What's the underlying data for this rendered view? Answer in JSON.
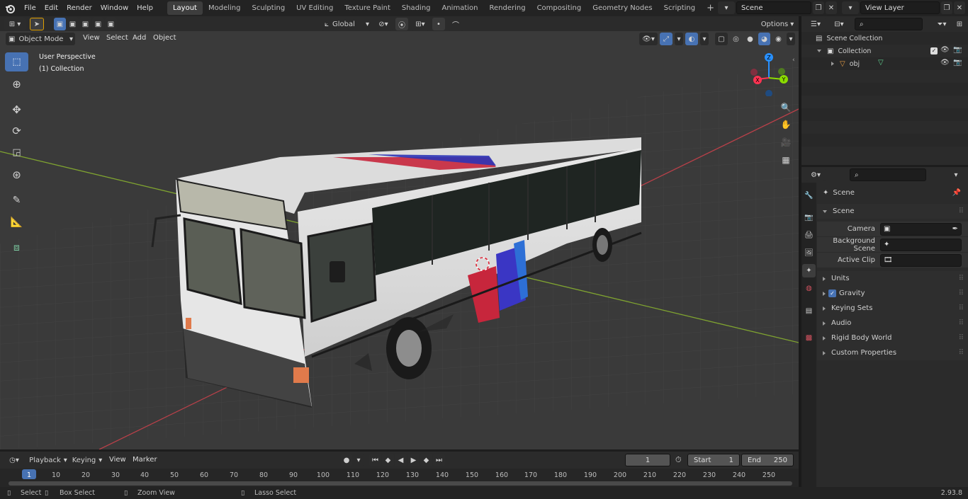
{
  "menus": [
    "File",
    "Edit",
    "Render",
    "Window",
    "Help"
  ],
  "workspaces": [
    "Layout",
    "Modeling",
    "Sculpting",
    "UV Editing",
    "Texture Paint",
    "Shading",
    "Animation",
    "Rendering",
    "Compositing",
    "Geometry Nodes",
    "Scripting"
  ],
  "active_workspace": "Layout",
  "scene_field": "Scene",
  "view_layer_field": "View Layer",
  "viewport_header": {
    "mode": "Object Mode",
    "menus": [
      "View",
      "Select",
      "Add",
      "Object"
    ],
    "transform_orientation": "Global",
    "options": "Options"
  },
  "viewport": {
    "perspective_label": "User Perspective",
    "collection_label": "(1) Collection",
    "gizmo": {
      "z": "Z",
      "y": "Y",
      "x": "X"
    }
  },
  "outliner": {
    "scene_collection": "Scene Collection",
    "collection": "Collection",
    "object": "obj"
  },
  "properties": {
    "breadcrumb": "Scene",
    "panel_title": "Scene",
    "camera_label": "Camera",
    "background_scene_label": "Background Scene",
    "active_clip_label": "Active Clip",
    "sections": [
      "Units",
      "Gravity",
      "Keying Sets",
      "Audio",
      "Rigid Body World",
      "Custom Properties"
    ],
    "gravity_checked": true
  },
  "timeline": {
    "menus": [
      "Playback",
      "Keying",
      "View",
      "Marker"
    ],
    "current_frame": "1",
    "start_label": "Start",
    "start_value": "1",
    "end_label": "End",
    "end_value": "250",
    "ticks": [
      "1",
      "10",
      "20",
      "30",
      "40",
      "50",
      "60",
      "70",
      "80",
      "90",
      "100",
      "110",
      "120",
      "130",
      "140",
      "150",
      "160",
      "170",
      "180",
      "190",
      "200",
      "210",
      "220",
      "230",
      "240",
      "250"
    ]
  },
  "status_bar": {
    "select": "Select",
    "box_select": "Box Select",
    "zoom_view": "Zoom View",
    "lasso_select": "Lasso Select",
    "version": "2.93.8"
  },
  "colors": {
    "accent": "#4772b3",
    "x_axis": "#ff3352",
    "y_axis": "#8bdc00",
    "z_axis": "#2890ff"
  }
}
